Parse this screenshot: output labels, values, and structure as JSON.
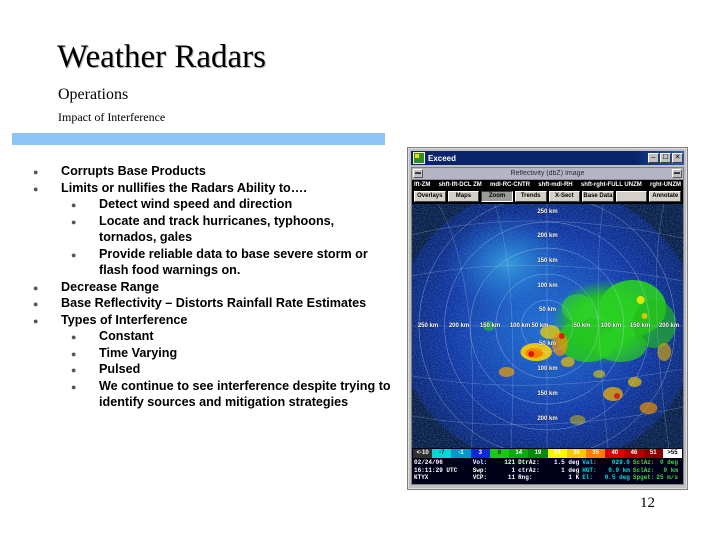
{
  "slide": {
    "title": "Weather Radars",
    "subtitle": "Operations",
    "subsubtitle": "Impact of Interference",
    "page_number": "12",
    "accent_color": "#8fc4f7"
  },
  "bullets": [
    {
      "level": 1,
      "text": "Corrupts Base Products"
    },
    {
      "level": 1,
      "text": "Limits or nullifies the Radars Ability to…."
    },
    {
      "level": 2,
      "text": "Detect wind speed and direction"
    },
    {
      "level": 2,
      "text": "Locate and track hurricanes, typhoons, tornados, gales"
    },
    {
      "level": 2,
      "text": "Provide reliable data to base severe storm or flash food warnings on."
    },
    {
      "level": 1,
      "text": "Decrease Range"
    },
    {
      "level": 1,
      "text": "Base Reflectivity – Distorts Rainfall Rate Estimates"
    },
    {
      "level": 1,
      "text": "Types of Interference"
    },
    {
      "level": 2,
      "text": "Constant"
    },
    {
      "level": 2,
      "text": "Time Varying"
    },
    {
      "level": 2,
      "text": "Pulsed"
    },
    {
      "level": 2,
      "text": "We continue to see interference despite trying to identify sources and mitigation strategies"
    }
  ],
  "radar_window": {
    "window_title": "Exceed",
    "window_buttons": [
      "–",
      "☐",
      "✕"
    ],
    "app_title": "Reflectivity (dbZ) Image",
    "menu_arrow_left": "▬",
    "menu_arrow_right": "▬",
    "label_row": [
      "lft-ZM",
      "shft-lft-DCL ZM",
      "mdl-RC-CNTR",
      "shft-mdl-RH",
      "shft-rght-FULL UNZM",
      "rght-UNZM"
    ],
    "buttons": [
      {
        "label": "Overlays",
        "pressed": false
      },
      {
        "label": "Maps",
        "pressed": false
      },
      {
        "label": "Zoom",
        "pressed": true
      },
      {
        "label": "Trends",
        "pressed": false
      },
      {
        "label": "X-Sect",
        "pressed": false
      },
      {
        "label": "Base Data",
        "pressed": false
      },
      {
        "label": "",
        "pressed": false
      },
      {
        "label": "Annotate",
        "pressed": false
      }
    ],
    "range_rings_vertical": [
      "250 km",
      "200 km",
      "150 km",
      "100 km",
      "50 km",
      "50 km",
      "100 km",
      "150 km",
      "200 km"
    ],
    "range_rings_horizontal": [
      "250 km",
      "200 km",
      "150 km",
      "100 km",
      "50 km",
      "50 km",
      "100 km",
      "150 km",
      "200 km"
    ],
    "color_scale": [
      {
        "label": "<-10",
        "color": "#303030"
      },
      {
        "label": "-7",
        "color": "#00d8d8"
      },
      {
        "label": "-1",
        "color": "#0098c8"
      },
      {
        "label": "3",
        "color": "#1028d8"
      },
      {
        "label": "8",
        "color": "#18c818"
      },
      {
        "label": "14",
        "color": "#10a810"
      },
      {
        "label": "19",
        "color": "#088808"
      },
      {
        "label": "24",
        "color": "#f8f800"
      },
      {
        "label": "30",
        "color": "#f8c800"
      },
      {
        "label": "35",
        "color": "#f88000"
      },
      {
        "label": "40",
        "color": "#d80000"
      },
      {
        "label": "46",
        "color": "#b00000"
      },
      {
        "label": "51",
        "color": "#880000"
      },
      {
        "label": ">55",
        "color": "#ffffff"
      }
    ],
    "readout": {
      "row1": [
        {
          "key": "02/24/06",
          "value": "",
          "style": "white-solo"
        },
        {
          "key": "Vol:",
          "value": "121",
          "style": "white"
        },
        {
          "key": "DtrAz:",
          "value": "1.5 deg",
          "style": "white"
        },
        {
          "key": "Val:",
          "value": "029.0",
          "style": "cyan"
        },
        {
          "key": "SclAz:",
          "value": "0 deg",
          "style": "green"
        }
      ],
      "row2": [
        {
          "key": "16:11:29 UTC",
          "value": "",
          "style": "white-solo"
        },
        {
          "key": "Swp:",
          "value": "1",
          "style": "white"
        },
        {
          "key": "ctrAz:",
          "value": "1 deg",
          "style": "white"
        },
        {
          "key": "HGT:",
          "value": "0.0 km",
          "style": "cyan"
        },
        {
          "key": "SclAz:",
          "value": "0 km",
          "style": "green"
        }
      ],
      "row3": [
        {
          "key": "KTYX",
          "value": "",
          "style": "white-solo"
        },
        {
          "key": "VCP:",
          "value": "11",
          "style": "white"
        },
        {
          "key": "Rng:",
          "value": "1 K",
          "style": "white"
        },
        {
          "key": "El:",
          "value": "0.5 deg",
          "style": "cyan"
        },
        {
          "key": "Spget:",
          "value": "25 m/s",
          "style": "green"
        }
      ]
    }
  }
}
